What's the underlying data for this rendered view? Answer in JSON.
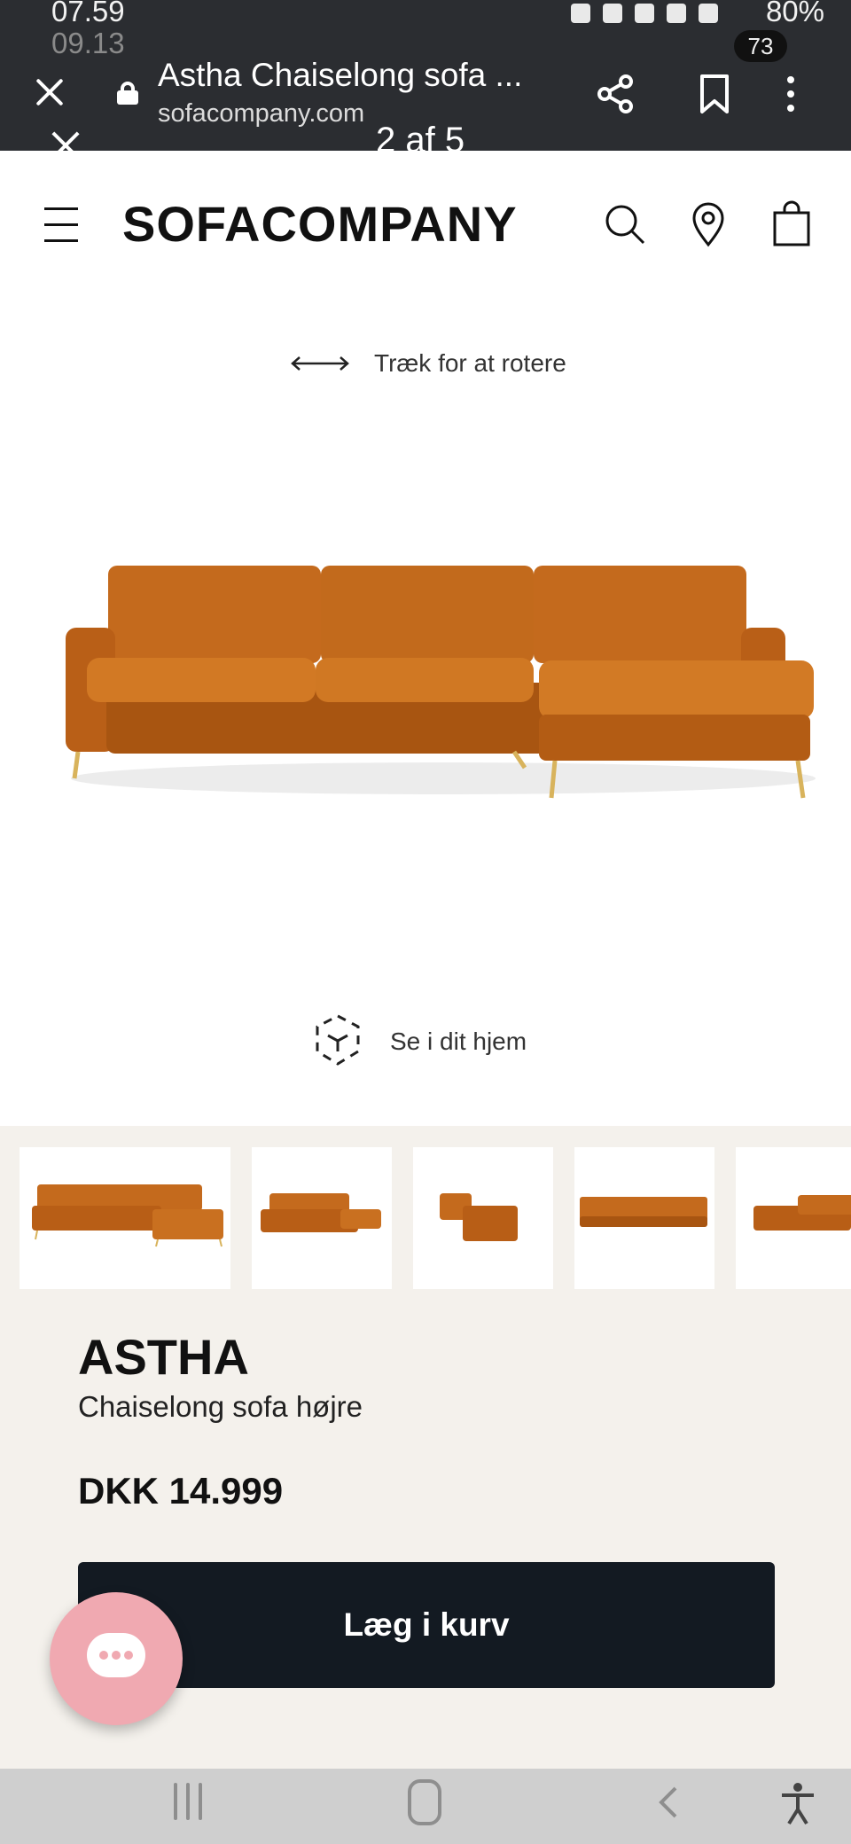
{
  "status_bar": {
    "time": "07.59",
    "time_secondary": "09.13",
    "battery": "80%",
    "notification_count": "73"
  },
  "browser": {
    "page_title": "Astha Chaiselong sofa ...",
    "domain": "sofacompany.com",
    "pager": "2 af 5"
  },
  "header": {
    "logo": "SOFACOMPANY"
  },
  "viewer": {
    "rotate_hint": "Træk for at rotere",
    "ar_label": "Se i dit hjem"
  },
  "product": {
    "name": "ASTHA",
    "subtitle": "Chaiselong sofa højre",
    "price": "DKK 14.999",
    "add_to_cart": "Læg i kurv"
  },
  "colors": {
    "sofa": "#c76c1d",
    "sofa_dark": "#9d4f12",
    "legs": "#d8b35c",
    "cart_button": "#131a22",
    "chat_button": "#f0a9b1",
    "lower_bg": "#f4f1ec"
  },
  "icons": [
    "close-icon",
    "lock-icon",
    "share-icon",
    "bookmark-icon",
    "more-icon",
    "hamburger-icon",
    "search-icon",
    "location-icon",
    "bag-icon",
    "rotate-arrow-icon",
    "ar-cube-icon",
    "chat-icon"
  ]
}
